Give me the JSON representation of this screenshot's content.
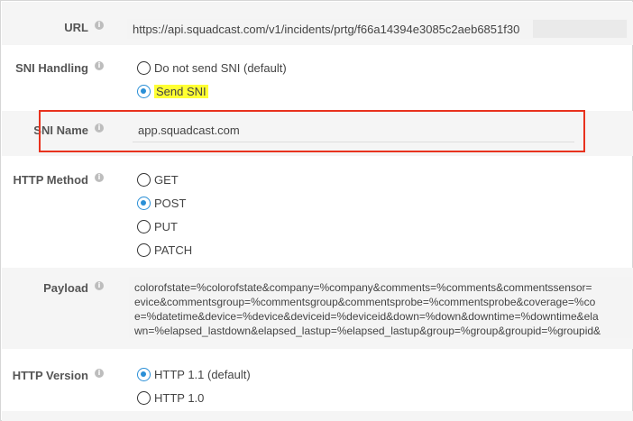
{
  "fields": {
    "url": {
      "label": "URL",
      "value": "https://api.squadcast.com/v1/incidents/prtg/f66a14394e3085c2aeb6851f30"
    },
    "sni_handling": {
      "label": "SNI Handling",
      "options": [
        "Do not send SNI (default)",
        "Send SNI"
      ],
      "selected": "Send SNI"
    },
    "sni_name": {
      "label": "SNI Name",
      "value": "app.squadcast.com"
    },
    "http_method": {
      "label": "HTTP Method",
      "options": [
        "GET",
        "POST",
        "PUT",
        "PATCH"
      ],
      "selected": "POST"
    },
    "payload": {
      "label": "Payload",
      "lines": [
        "colorofstate=%colorofstate&company=%company&comments=%comments&commentssensor=",
        "evice&commentsgroup=%commentsgroup&commentsprobe=%commentsprobe&coverage=%co",
        "e=%datetime&device=%device&deviceid=%deviceid&down=%down&downtime=%downtime&ela",
        "wn=%elapsed_lastdown&elapsed_lastup=%elapsed_lastup&group=%group&groupid=%groupid&"
      ]
    },
    "http_version": {
      "label": "HTTP Version",
      "options": [
        "HTTP 1.1 (default)",
        "HTTP 1.0"
      ],
      "selected": "HTTP 1.1 (default)"
    }
  },
  "icons": {
    "info": "info-icon"
  },
  "colors": {
    "accent": "#2a8fd6",
    "highlight": "#ffff33",
    "annotation_box": "#e8321e",
    "row_background": "#f5f5f5"
  }
}
